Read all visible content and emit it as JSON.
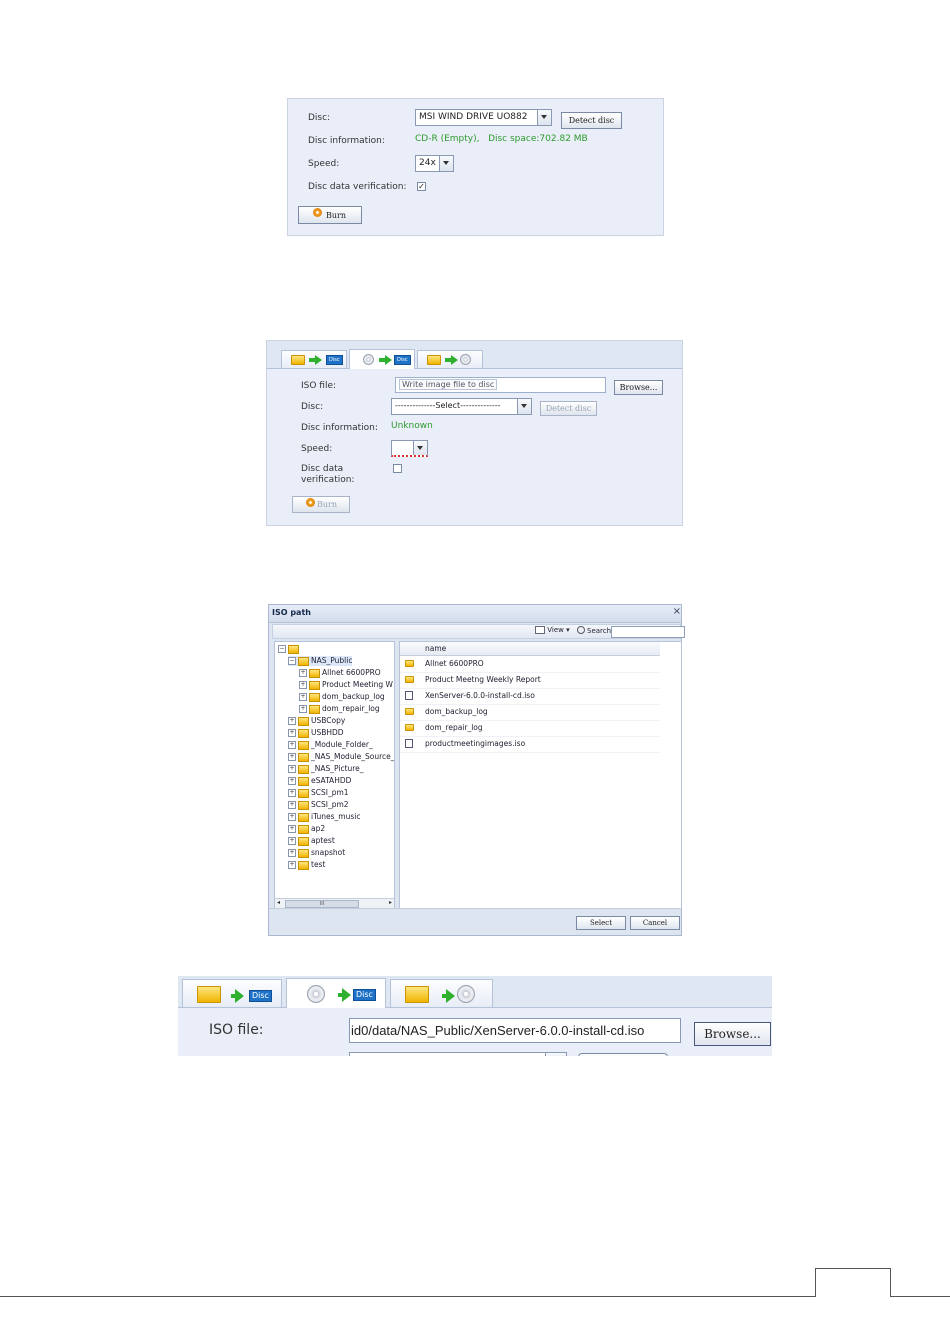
{
  "burn_panel": {
    "disc_label": "Disc:",
    "disc_value": "MSI WIND DRIVE UO882",
    "detect_button": "Detect disc",
    "disc_info_label": "Disc information:",
    "disc_info_value": "CD-R (Empty),   Disc space:702.82 MB",
    "speed_label": "Speed:",
    "speed_value": "24x",
    "verify_label": "Disc data verification:",
    "verify_checked": "✓",
    "burn_button": "Burn"
  },
  "iso_panel": {
    "tabs": [
      {
        "badge": "Disc",
        "icon": "folder-to-disc-icon"
      },
      {
        "badge": "Disc",
        "icon": "disc-to-disc-icon"
      },
      {
        "badge": "",
        "icon": "folder-to-cd-icon"
      }
    ],
    "iso_label": "ISO file:",
    "iso_placeholder": "Write image file to disc",
    "browse_button": "Browse...",
    "disc_label": "Disc:",
    "disc_value": "--------------Select--------------",
    "detect_button": "Detect disc",
    "disc_info_label": "Disc information:",
    "disc_info_value": "Unknown",
    "speed_label": "Speed:",
    "speed_value": "",
    "verify_label_1": "Disc data",
    "verify_label_2": "verification:",
    "burn_button": "Burn"
  },
  "iso_dialog": {
    "title": "ISO path",
    "view_label": "View ▾",
    "search_label": "Search",
    "tree": {
      "root": "",
      "nas_public": "NAS_Public",
      "nas_children": [
        "Allnet 6600PRO",
        "Product Meeting W",
        "dom_backup_log",
        "dom_repair_log"
      ],
      "others": [
        "USBCopy",
        "USBHDD",
        "_Module_Folder_",
        "_NAS_Module_Source_",
        "_NAS_Picture_",
        "eSATAHDD",
        "SCSI_pm1",
        "SCSI_pm2",
        "iTunes_music",
        "ap2",
        "aptest",
        "snapshot",
        "test"
      ]
    },
    "scroll_thumb": "III",
    "column_header": "name",
    "files": [
      {
        "name": "Allnet 6600PRO",
        "type": "folder"
      },
      {
        "name": "Product Meetng Weekly Report",
        "type": "folder"
      },
      {
        "name": "XenServer-6.0.0-install-cd.iso",
        "type": "iso"
      },
      {
        "name": "dom_backup_log",
        "type": "folder"
      },
      {
        "name": "dom_repair_log",
        "type": "folder"
      },
      {
        "name": "productmeetingimages.iso",
        "type": "iso"
      }
    ],
    "select_button": "Select",
    "cancel_button": "Cancel"
  },
  "zoom_panel": {
    "tab_badges": [
      "Disc",
      "Disc"
    ],
    "iso_label": "ISO file:",
    "iso_value": "id0/data/NAS_Public/XenServer-6.0.0-install-cd.iso",
    "browse_button": "Browse..."
  },
  "colors": {
    "panel_bg": "#e9eef8",
    "info_green": "#2e9a2e",
    "badge_blue": "#1e73c8"
  }
}
